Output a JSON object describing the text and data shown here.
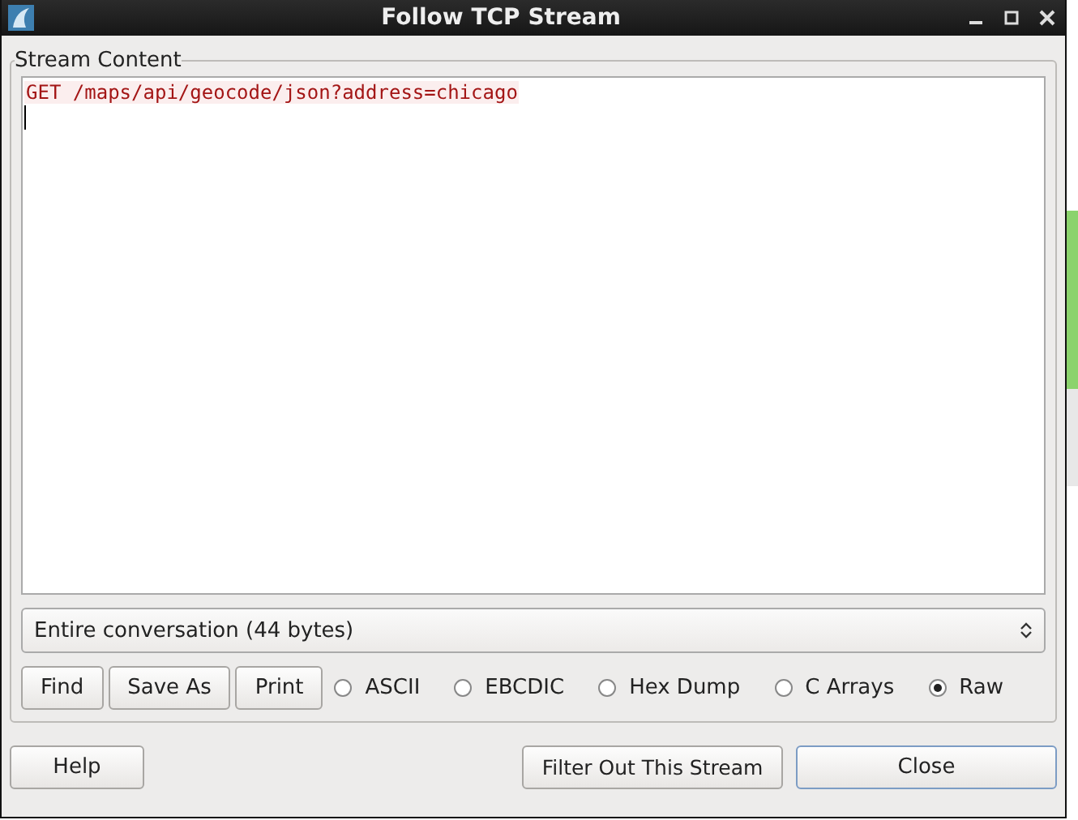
{
  "window": {
    "title": "Follow TCP Stream"
  },
  "stream_content": {
    "label": "Stream Content",
    "lines": [
      {
        "text": "GET /maps/api/geocode/json?address=chicago"
      }
    ],
    "conversation": "Entire conversation (44 bytes)",
    "buttons": [
      "Find",
      "Save As",
      "Print"
    ],
    "formats": [
      {
        "label": "ASCII",
        "selected": false
      },
      {
        "label": "EBCDIC",
        "selected": false
      },
      {
        "label": "Hex Dump",
        "selected": false
      },
      {
        "label": "C Arrays",
        "selected": false
      },
      {
        "label": "Raw",
        "selected": true
      }
    ]
  },
  "footer": {
    "help": "Help",
    "filter": "Filter Out This Stream",
    "close": "Close"
  }
}
